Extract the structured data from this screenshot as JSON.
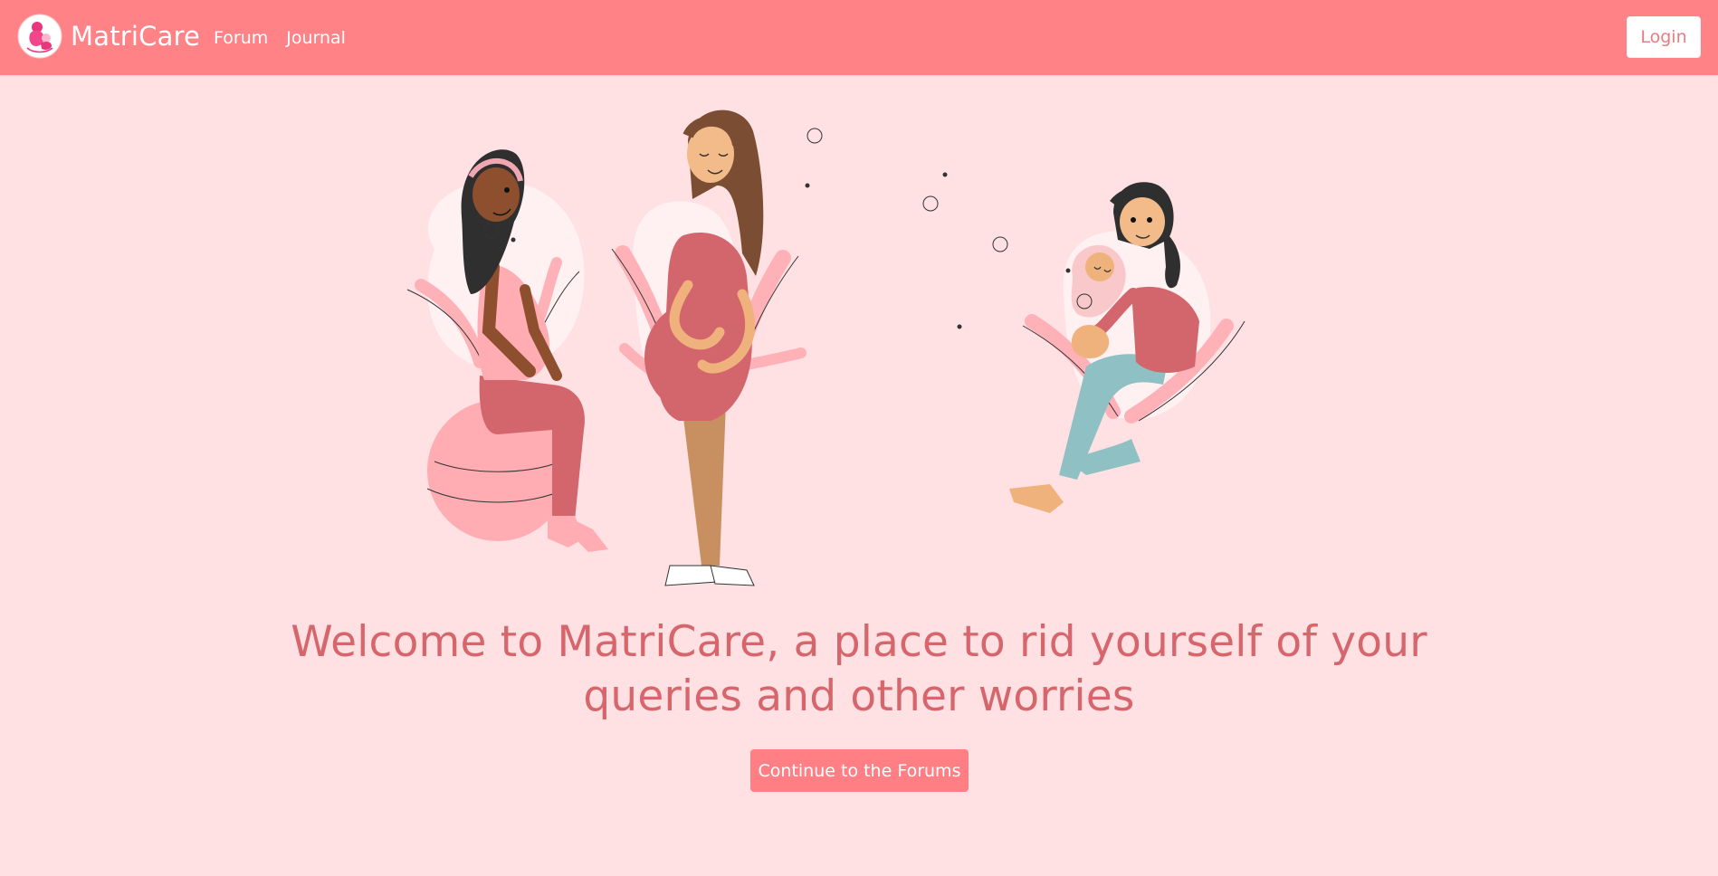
{
  "navbar": {
    "brand_name": "MatriCare",
    "links": [
      {
        "label": "Forum"
      },
      {
        "label": "Journal"
      }
    ],
    "login_label": "Login"
  },
  "hero": {
    "title": "Welcome to MatriCare, a place to rid yourself of your queries and other worries",
    "cta_label": "Continue to the Forums",
    "illustration": {
      "figures": [
        "woman-sitting-on-exercise-ball",
        "pregnant-woman-standing",
        "mother-holding-baby"
      ]
    }
  },
  "colors": {
    "navbar_bg": "#ff8287",
    "page_bg": "#ffe1e3",
    "accent": "#ff7f85",
    "title_text": "#d6666c"
  },
  "icons": [
    "matricare-logo-icon"
  ]
}
